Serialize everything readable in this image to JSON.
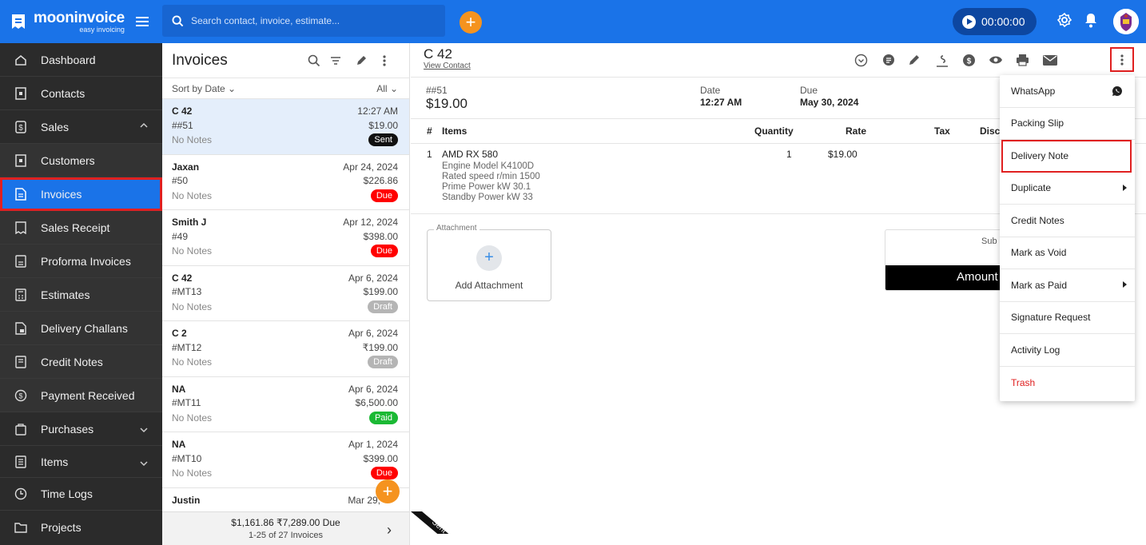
{
  "app": {
    "brand": "mooninvoice",
    "tagline": "easy invoicing"
  },
  "search": {
    "placeholder": "Search contact, invoice, estimate..."
  },
  "timer": {
    "value": "00:00:00"
  },
  "sidebar": {
    "items": [
      {
        "label": "Dashboard",
        "icon": "home-icon"
      },
      {
        "label": "Contacts",
        "icon": "contacts-icon"
      },
      {
        "label": "Sales",
        "icon": "dollar-icon"
      },
      {
        "label": "Customers",
        "icon": "customers-icon"
      },
      {
        "label": "Invoices",
        "icon": "invoice-icon"
      },
      {
        "label": "Sales Receipt",
        "icon": "receipt-icon"
      },
      {
        "label": "Proforma Invoices",
        "icon": "proforma-icon"
      },
      {
        "label": "Estimates",
        "icon": "calculator-icon"
      },
      {
        "label": "Delivery Challans",
        "icon": "challan-icon"
      },
      {
        "label": "Credit Notes",
        "icon": "credit-note-icon"
      },
      {
        "label": "Payment Received",
        "icon": "payment-icon"
      },
      {
        "label": "Purchases",
        "icon": "purchases-icon"
      },
      {
        "label": "Items",
        "icon": "items-icon"
      },
      {
        "label": "Time Logs",
        "icon": "clock-icon"
      },
      {
        "label": "Projects",
        "icon": "folder-icon"
      }
    ]
  },
  "list": {
    "title": "Invoices",
    "sort_label": "Sort by Date",
    "filter_label": "All",
    "rows": [
      {
        "name": "C 42",
        "date": "12:27 AM",
        "number": "##51",
        "amount": "$19.00",
        "notes": "No Notes",
        "status": "Sent"
      },
      {
        "name": "Jaxan",
        "date": "Apr 24, 2024",
        "number": "#50",
        "amount": "$226.86",
        "notes": "No Notes",
        "status": "Due"
      },
      {
        "name": "Smith J",
        "date": "Apr 12, 2024",
        "number": "#49",
        "amount": "$398.00",
        "notes": "No Notes",
        "status": "Due"
      },
      {
        "name": "C 42",
        "date": "Apr 6, 2024",
        "number": "#MT13",
        "amount": "$199.00",
        "notes": "No Notes",
        "status": "Draft"
      },
      {
        "name": "C 2",
        "date": "Apr 6, 2024",
        "number": "#MT12",
        "amount": "₹199.00",
        "notes": "No Notes",
        "status": "Draft"
      },
      {
        "name": "NA",
        "date": "Apr 6, 2024",
        "number": "#MT11",
        "amount": "$6,500.00",
        "notes": "No Notes",
        "status": "Paid"
      },
      {
        "name": "NA",
        "date": "Apr 1, 2024",
        "number": "#MT10",
        "amount": "$399.00",
        "notes": "No Notes",
        "status": "Due"
      },
      {
        "name": "Justin",
        "date": "Mar 29,",
        "number": "",
        "amount": "",
        "notes": "",
        "status": ""
      }
    ],
    "footer_totals": "$1,161.86 ₹7,289.00 Due",
    "footer_range": "1-25 of 27 Invoices"
  },
  "detail": {
    "title": "C 42",
    "view_contact": "View Contact",
    "number": "##51",
    "amount": "$19.00",
    "date_label": "Date",
    "date_value": "12:27 AM",
    "due_label": "Due",
    "due_value": "May 30, 2024",
    "columns": {
      "hash": "#",
      "items": "Items",
      "quantity": "Quantity",
      "rate": "Rate",
      "tax": "Tax",
      "disc": "Disc"
    },
    "item": {
      "index": "1",
      "name": "AMD RX 580",
      "desc": [
        "Engine Model K4100D",
        "Rated speed r/min 1500",
        "Prime Power kW 30.1",
        "Standby Power kW 33"
      ],
      "quantity": "1",
      "rate": "$19.00"
    },
    "attachment_legend": "Attachment",
    "attachment_label": "Add Attachment",
    "subtotal_label": "Sub",
    "amount_label": "Amount",
    "ribbon": "Sent"
  },
  "menu": {
    "items": [
      {
        "label": "WhatsApp"
      },
      {
        "label": "Packing Slip"
      },
      {
        "label": "Delivery Note"
      },
      {
        "label": "Duplicate"
      },
      {
        "label": "Credit Notes"
      },
      {
        "label": "Mark as Void"
      },
      {
        "label": "Mark as Paid"
      },
      {
        "label": "Signature Request"
      },
      {
        "label": "Activity Log"
      },
      {
        "label": "Trash"
      }
    ]
  },
  "colors": {
    "primary": "#1a73e8",
    "accent": "#f5931f",
    "highlight": "#e02020",
    "sidebar": "#2b2b2b"
  }
}
